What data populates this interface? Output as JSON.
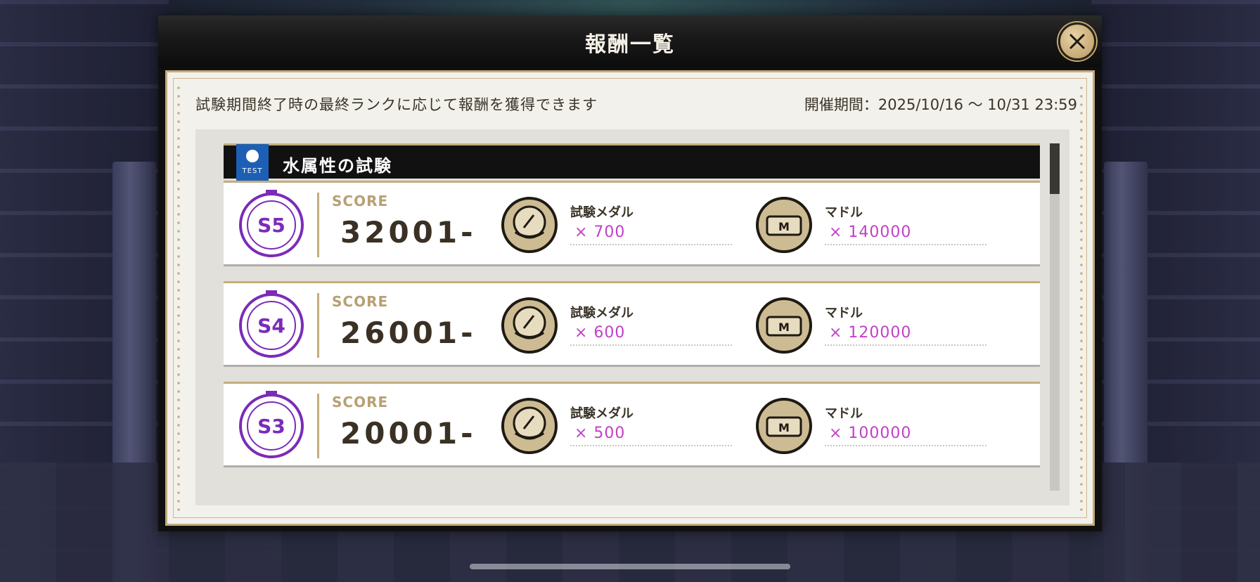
{
  "modal": {
    "title": "報酬一覧",
    "close_icon": "close-icon",
    "info_text": "試験期間終了時の最終ランクに応じて報酬を獲得できます",
    "period_text": "開催期間：2025/10/16 〜 10/31 23:59"
  },
  "section": {
    "badge_text": "TEST",
    "title": "水属性の試験"
  },
  "rows": [
    {
      "rank": "S5",
      "score_label": "SCORE",
      "score": "32001-",
      "rewards": [
        {
          "icon": "exam-medal-icon",
          "name": "試験メダル",
          "qty": "× 700"
        },
        {
          "icon": "madol-icon",
          "name": "マドル",
          "qty": "× 140000"
        }
      ]
    },
    {
      "rank": "S4",
      "score_label": "SCORE",
      "score": "26001-",
      "rewards": [
        {
          "icon": "exam-medal-icon",
          "name": "試験メダル",
          "qty": "× 600"
        },
        {
          "icon": "madol-icon",
          "name": "マドル",
          "qty": "× 120000"
        }
      ]
    },
    {
      "rank": "S3",
      "score_label": "SCORE",
      "score": "20001-",
      "rewards": [
        {
          "icon": "exam-medal-icon",
          "name": "試験メダル",
          "qty": "× 500"
        },
        {
          "icon": "madol-icon",
          "name": "マドル",
          "qty": "× 100000"
        }
      ]
    }
  ],
  "colors": {
    "accent_gold": "#c4ad7c",
    "rank_purple": "#7b2bb8",
    "qty_magenta": "#c23fc8",
    "section_blue": "#1d5fb4"
  }
}
